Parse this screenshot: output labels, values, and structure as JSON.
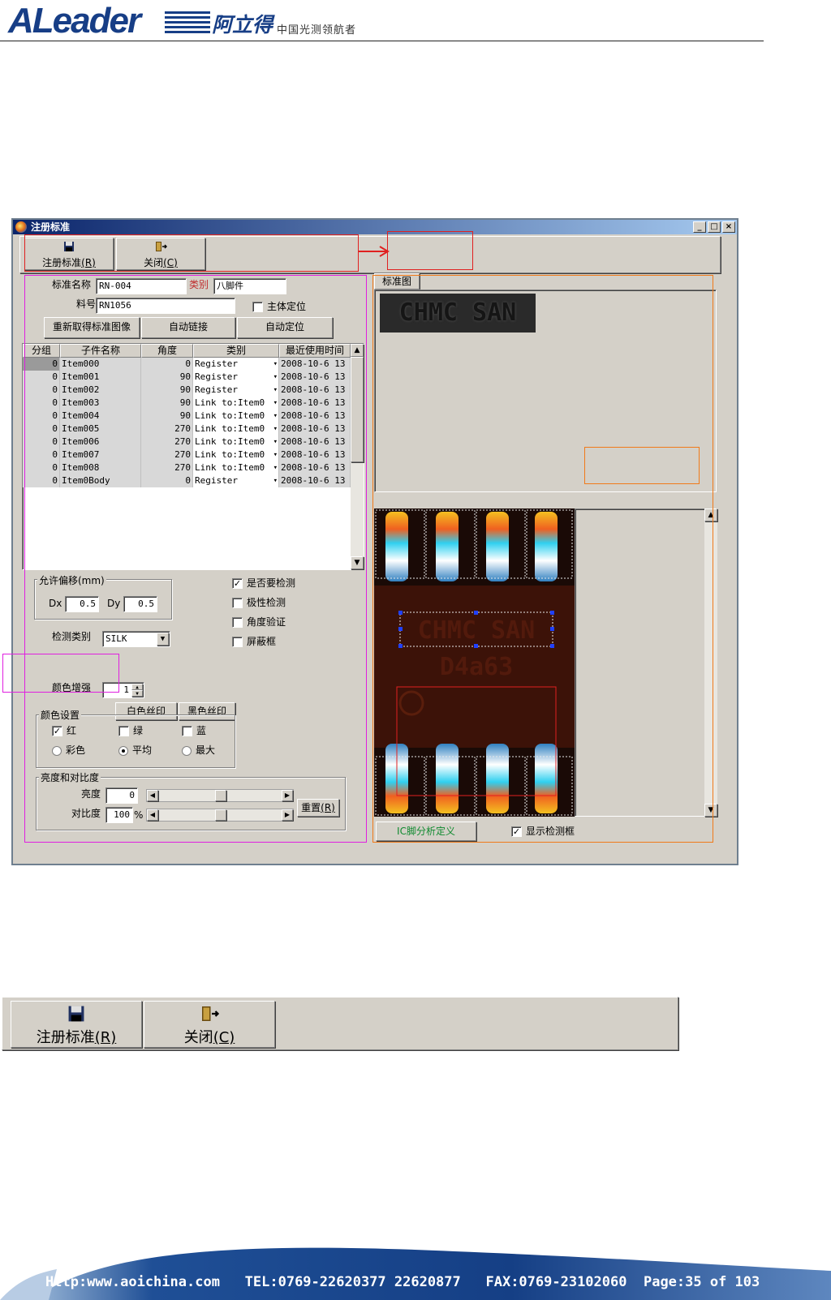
{
  "header": {
    "logo_text": "ALeader",
    "logo_cn": "阿立得",
    "slogan": "中国光测领航者"
  },
  "window": {
    "title": "注册标准",
    "controls": [
      "_",
      "□",
      "×"
    ]
  },
  "toolbar": {
    "register_label": "注册标准",
    "register_key": "(R)",
    "register_icon": "save-icon",
    "close_label": "关闭",
    "close_key": "(C)",
    "close_icon": "exit-icon"
  },
  "form": {
    "std_name_label": "标准名称",
    "std_name_value": "RN-004",
    "category_label": "类别",
    "category_value": "八脚件",
    "part_no_label": "料号",
    "part_no_value": "RN1056",
    "main_locate_label": "主体定位",
    "main_locate_checked": false,
    "btn_reacquire": "重新取得标准图像",
    "btn_auto_link": "自动链接",
    "btn_auto_locate": "自动定位"
  },
  "table": {
    "columns": [
      "分组",
      "子件名称",
      "角度",
      "类别",
      "最近使用时间"
    ],
    "rows": [
      {
        "group": "0",
        "name": "Item000",
        "angle": "0",
        "type": "Register",
        "time": "2008-10-6 13"
      },
      {
        "group": "0",
        "name": "Item001",
        "angle": "90",
        "type": "Register",
        "time": "2008-10-6 13"
      },
      {
        "group": "0",
        "name": "Item002",
        "angle": "90",
        "type": "Register",
        "time": "2008-10-6 13"
      },
      {
        "group": "0",
        "name": "Item003",
        "angle": "90",
        "type": "Link to:Item0",
        "time": "2008-10-6 13"
      },
      {
        "group": "0",
        "name": "Item004",
        "angle": "90",
        "type": "Link to:Item0",
        "time": "2008-10-6 13"
      },
      {
        "group": "0",
        "name": "Item005",
        "angle": "270",
        "type": "Link to:Item0",
        "time": "2008-10-6 13"
      },
      {
        "group": "0",
        "name": "Item006",
        "angle": "270",
        "type": "Link to:Item0",
        "time": "2008-10-6 13"
      },
      {
        "group": "0",
        "name": "Item007",
        "angle": "270",
        "type": "Link to:Item0",
        "time": "2008-10-6 13"
      },
      {
        "group": "0",
        "name": "Item008",
        "angle": "270",
        "type": "Link to:Item0",
        "time": "2008-10-6 13"
      },
      {
        "group": "0",
        "name": "Item0Body",
        "angle": "0",
        "type": "Register",
        "time": "2008-10-6 13"
      }
    ]
  },
  "offset": {
    "group_label": "允许偏移(mm)",
    "dx_label": "Dx",
    "dx_value": "0.5",
    "dy_label": "Dy",
    "dy_value": "0.5"
  },
  "checks": {
    "need_inspect": {
      "label": "是否要检测",
      "checked": true
    },
    "polarity": {
      "label": "极性检测",
      "checked": false
    },
    "angle_verify": {
      "label": "角度验证",
      "checked": false
    },
    "mask_frame": {
      "label": "屏蔽框",
      "checked": false
    }
  },
  "inspect": {
    "type_label": "检测类别",
    "type_value": "SILK"
  },
  "color": {
    "enhance_label": "颜色增强",
    "enhance_value": "1",
    "btn_white_silk": "白色丝印",
    "btn_black_silk": "黑色丝印",
    "group_label": "颜色设置",
    "red": {
      "label": "红",
      "checked": true
    },
    "green": {
      "label": "绿",
      "checked": false
    },
    "blue": {
      "label": "蓝",
      "checked": false
    },
    "mode_color": {
      "label": "彩色",
      "selected": false
    },
    "mode_avg": {
      "label": "平均",
      "selected": true
    },
    "mode_max": {
      "label": "最大",
      "selected": false
    }
  },
  "bc": {
    "group_label": "亮度和对比度",
    "brightness_label": "亮度",
    "brightness_value": "0",
    "contrast_label": "对比度",
    "contrast_value": "100",
    "contrast_unit": "%",
    "reset_label": "重置",
    "reset_key": "(R)"
  },
  "preview": {
    "tab_label": "标准图",
    "chip_text": "CHMC SAN",
    "chip_text2": "D4a63"
  },
  "bottom": {
    "ic_pin_label": "IC脚分析定义",
    "show_frame_label": "显示检测框",
    "show_frame_checked": true
  },
  "footer": {
    "website": "Http:www.aoichina.com",
    "tel": "TEL:0769-22620377 22620877",
    "fax": "FAX:0769-23102060",
    "page": "Page:35 of 103"
  },
  "colors": {
    "brand_blue": "#173e86",
    "annotation_red": "#e02020",
    "annotation_pink": "#e020e0",
    "annotation_orange": "#f07a1a"
  }
}
